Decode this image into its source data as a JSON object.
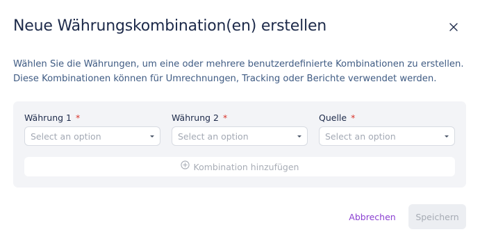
{
  "dialog": {
    "title": "Neue Währungskombination(en) erstellen",
    "close_icon": "close-icon",
    "description_line1": "Wählen Sie die Währungen, um eine oder mehrere benutzerdefinierte Kombinationen zu erstellen.",
    "description_line2": "Diese Kombinationen können für Umrechnungen, Tracking oder Berichte verwendet werden."
  },
  "form": {
    "fields": [
      {
        "label": "Währung 1",
        "required_marker": "*",
        "placeholder": "Select an option"
      },
      {
        "label": "Währung 2",
        "required_marker": "*",
        "placeholder": "Select an option"
      },
      {
        "label": "Quelle",
        "required_marker": "*",
        "placeholder": "Select an option"
      }
    ],
    "add_combination_label": "Kombination hinzufügen",
    "add_icon": "plus-circle-icon"
  },
  "footer": {
    "cancel_label": "Abbrechen",
    "save_label": "Speichern"
  },
  "colors": {
    "accent": "#8a3fd1",
    "required": "#d9342b",
    "panel_bg": "#f3f4f7"
  }
}
